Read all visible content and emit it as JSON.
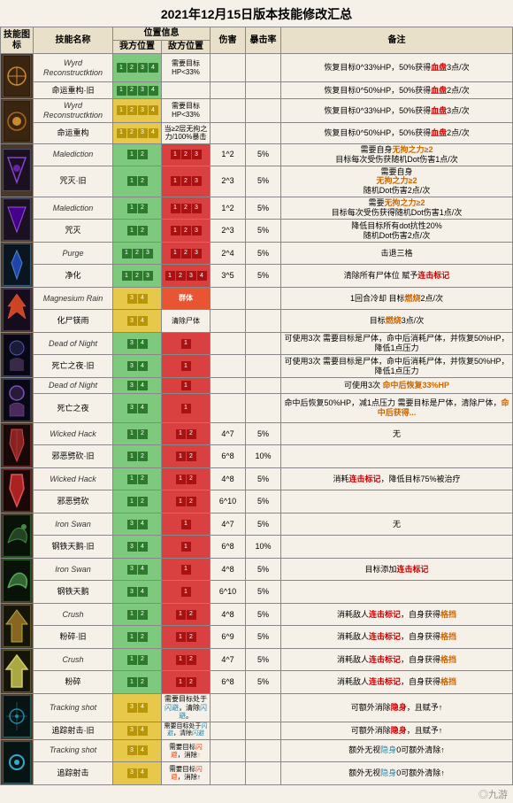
{
  "title": "2021年12月15日版本技能修改汇总",
  "header": {
    "col1": "技能图标",
    "col2": "技能名称",
    "col3_group": "位置信息",
    "col3a": "我方位置",
    "col3b": "敌方位置",
    "col4": "伤害",
    "col5": "暴击率",
    "col6": "备注"
  },
  "rows": [
    {
      "en": "Wyrd Reconstructktion",
      "cn": "命运重构·旧",
      "my_pos": [
        1,
        2,
        3,
        4
      ],
      "enemy_pos": "需要目标HP<33%",
      "dmg": "",
      "crit": "",
      "note": "恢复目标0^33%HP，50%获得血盘3点/次",
      "note_color": "red",
      "is_old": true
    },
    {
      "en": "",
      "cn": "命运重构",
      "my_pos": [
        1,
        2,
        3,
        4
      ],
      "enemy_pos": "",
      "dmg": "",
      "crit": "",
      "note": "恢复目标0^50%HP，50%获得血盘2点/次",
      "is_old": false
    },
    {
      "en": "Wyrd Reconstructktion",
      "cn": "命运重构·旧",
      "my_pos": [],
      "enemy_pos": "需要目标HP<33%",
      "dmg": "",
      "crit": "",
      "note": "恢复目标0^33%HP，50%获得血盘3点/次",
      "is_old": true
    },
    {
      "en": "",
      "cn": "命运重构",
      "my_pos": [],
      "enemy_pos": "当≥2层无拘之力/100%暴击",
      "dmg": "",
      "crit": "",
      "note": "恢复目标0^50%HP，50%获得血盘2点/次",
      "is_old": false
    }
  ],
  "watermark": "◎九游"
}
